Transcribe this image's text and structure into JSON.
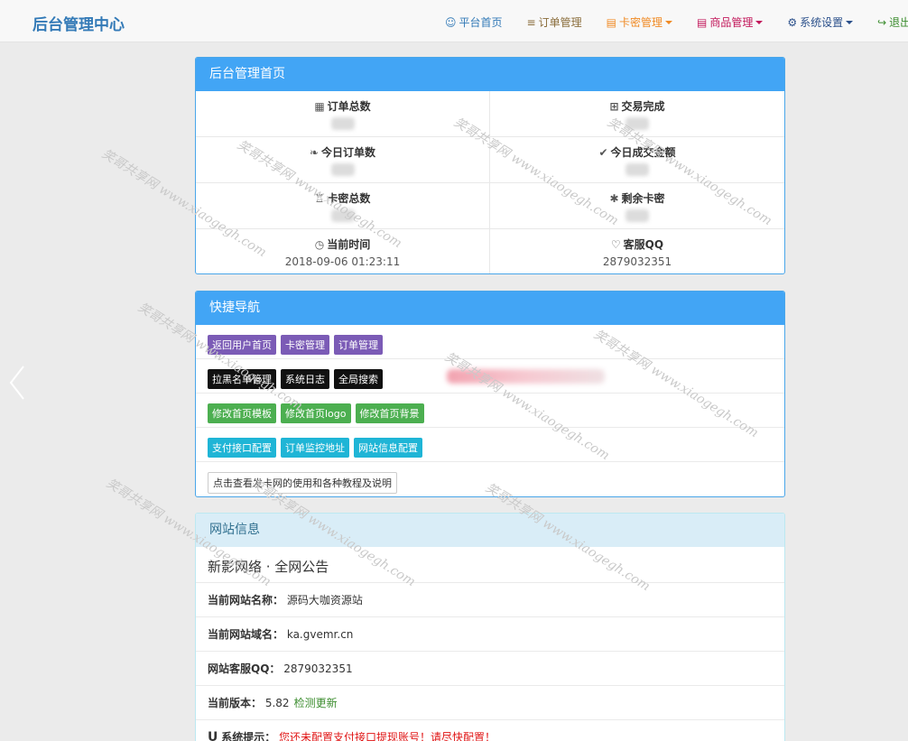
{
  "brand": "后台管理中心",
  "nav": [
    {
      "label": "平台首页",
      "icon": "user-icon",
      "color": "#337ab7",
      "dropdown": false
    },
    {
      "label": "订单管理",
      "icon": "list-icon",
      "color": "#8a6d3b",
      "dropdown": false
    },
    {
      "label": "卡密管理",
      "icon": "card-icon",
      "color": "#f08a24",
      "dropdown": true
    },
    {
      "label": "商品管理",
      "icon": "goods-icon",
      "color": "#c2185b",
      "dropdown": true
    },
    {
      "label": "系统设置",
      "icon": "gear-icon",
      "color": "#2a4f8a",
      "dropdown": true
    },
    {
      "label": "退出登录",
      "icon": "logout-icon",
      "color": "#3c8d2f",
      "dropdown": false
    }
  ],
  "dashboard": {
    "title": "后台管理首页",
    "stats": [
      {
        "label": "订单总数",
        "icon": "grid-icon",
        "value": ""
      },
      {
        "label": "交易完成",
        "icon": "cart-icon",
        "value": ""
      },
      {
        "label": "今日订单数",
        "icon": "leaf-icon",
        "value": ""
      },
      {
        "label": "今日成交金额",
        "icon": "check-icon",
        "value": ""
      },
      {
        "label": "卡密总数",
        "icon": "tree-icon",
        "value": ""
      },
      {
        "label": "剩余卡密",
        "icon": "asterisk-icon",
        "value": ""
      },
      {
        "label": "当前时间",
        "icon": "clock-icon",
        "value": "2018-09-06 01:23:11"
      },
      {
        "label": "客服QQ",
        "icon": "heart-icon",
        "value": "2879032351"
      }
    ]
  },
  "quick_nav": {
    "title": "快捷导航",
    "rows": [
      [
        {
          "label": "返回用户首页",
          "style": "purple"
        },
        {
          "label": "卡密管理",
          "style": "purple"
        },
        {
          "label": "订单管理",
          "style": "purple"
        }
      ],
      [
        {
          "label": "拉黑名单管理",
          "style": "black"
        },
        {
          "label": "系统日志",
          "style": "black"
        },
        {
          "label": "全局搜索",
          "style": "black"
        }
      ],
      [
        {
          "label": "修改首页模板",
          "style": "green"
        },
        {
          "label": "修改首页logo",
          "style": "green"
        },
        {
          "label": "修改首页背景",
          "style": "green"
        }
      ],
      [
        {
          "label": "支付接口配置",
          "style": "cyan"
        },
        {
          "label": "订单监控地址",
          "style": "cyan"
        },
        {
          "label": "网站信息配置",
          "style": "cyan"
        }
      ],
      [
        {
          "label": "点击查看发卡网的使用和各种教程及说明",
          "style": "white"
        }
      ]
    ]
  },
  "site_info": {
    "title": "网站信息",
    "announcement": "新影网络 · 全网公告",
    "site_name_label": "当前网站名称：",
    "site_name": "源码大咖资源站",
    "domain_label": "当前网站域名：",
    "domain": "ka.gvemr.cn",
    "qq_label": "网站客服QQ：",
    "qq": "2879032351",
    "version_label": "当前版本：",
    "version": "5.82",
    "check_update": "检测更新",
    "tip_label": "系统提示：",
    "tip": "您还未配置支付接口提现账号！请尽快配置！"
  },
  "watermark": "笑哥共享网 www.xiaogegh.com",
  "colors": {
    "primary": "#42a5f5",
    "brand": "#337ab7",
    "alert": "#e01414"
  }
}
